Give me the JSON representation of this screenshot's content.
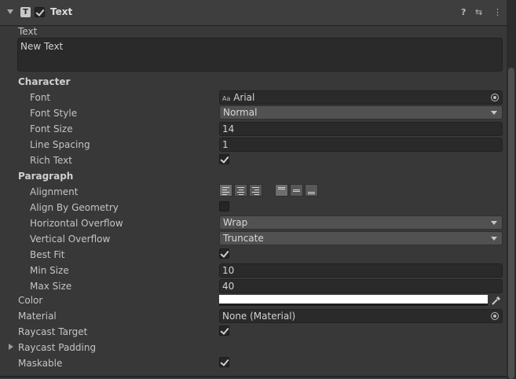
{
  "header": {
    "icon_letter": "T",
    "title": "Text",
    "help_icon": "?",
    "preset_icon": "⇆",
    "menu_icon": "⋮"
  },
  "text_property": {
    "label": "Text",
    "value": "New Text"
  },
  "character": {
    "heading": "Character",
    "font_label": "Font",
    "font_prefix": "Aa",
    "font_value": "Arial",
    "font_style_label": "Font Style",
    "font_style_value": "Normal",
    "font_size_label": "Font Size",
    "font_size_value": "14",
    "line_spacing_label": "Line Spacing",
    "line_spacing_value": "1",
    "rich_text_label": "Rich Text"
  },
  "paragraph": {
    "heading": "Paragraph",
    "alignment_label": "Alignment",
    "align_by_geometry_label": "Align By Geometry",
    "horizontal_overflow_label": "Horizontal Overflow",
    "horizontal_overflow_value": "Wrap",
    "vertical_overflow_label": "Vertical Overflow",
    "vertical_overflow_value": "Truncate",
    "best_fit_label": "Best Fit",
    "min_size_label": "Min Size",
    "min_size_value": "10",
    "max_size_label": "Max Size",
    "max_size_value": "40"
  },
  "color": {
    "label": "Color",
    "value": "#ffffff"
  },
  "material": {
    "label": "Material",
    "value": "None (Material)"
  },
  "raycast_target": {
    "label": "Raycast Target"
  },
  "raycast_padding": {
    "label": "Raycast Padding"
  },
  "maskable": {
    "label": "Maskable"
  }
}
